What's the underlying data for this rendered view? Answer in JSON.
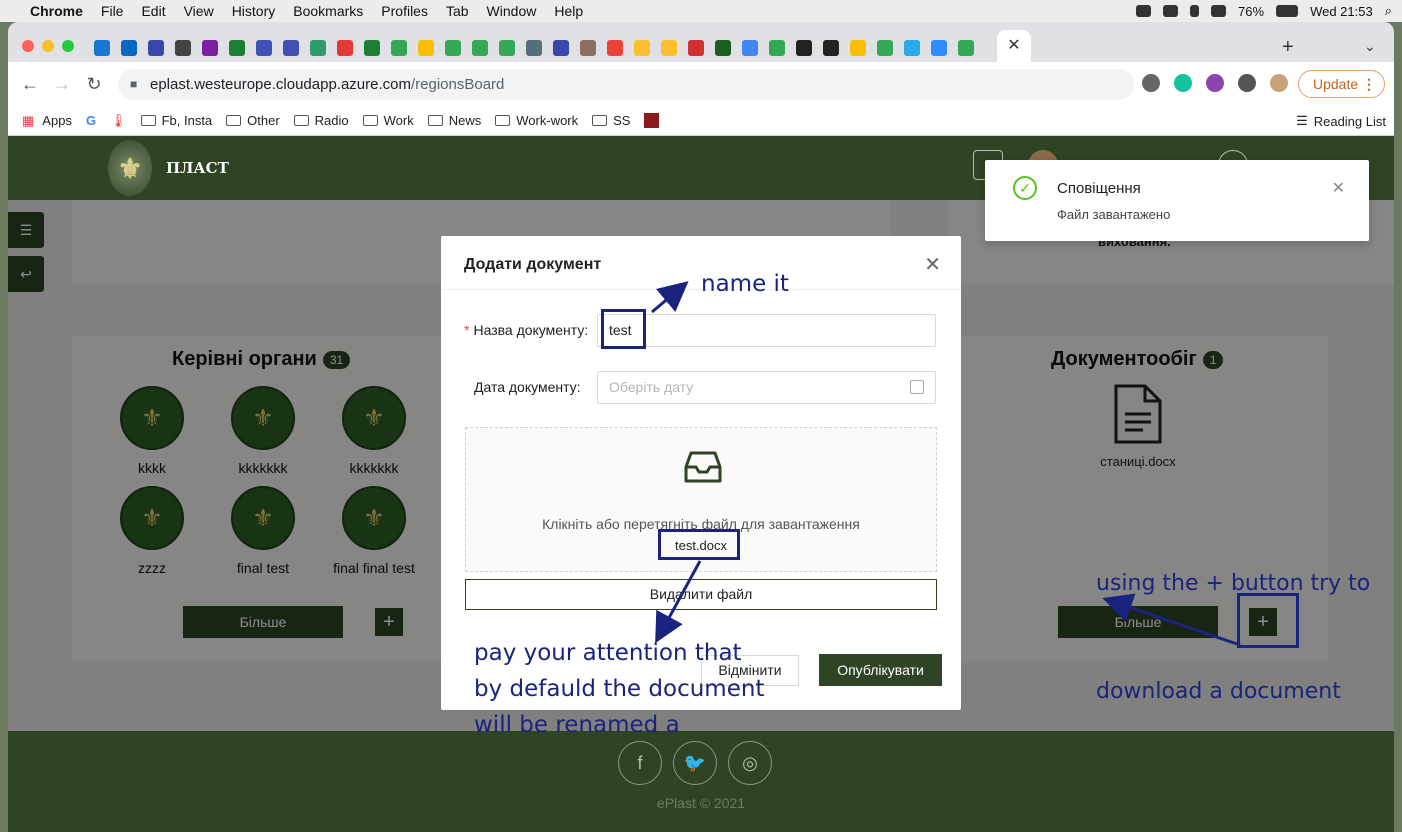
{
  "menubar": {
    "app": "Chrome",
    "items": [
      "File",
      "Edit",
      "View",
      "History",
      "Bookmarks",
      "Profiles",
      "Tab",
      "Window",
      "Help"
    ],
    "battery": "76%",
    "clock": "Wed 21:53"
  },
  "browser": {
    "url_host": "eplast.westeurope.cloudapp.azure.com",
    "url_path": "/regionsBoard",
    "update_label": "Update",
    "bookmarks": {
      "apps": "Apps",
      "items": [
        "Fb, Insta",
        "Other",
        "Radio",
        "Work",
        "News",
        "Work-work",
        "SS"
      ],
      "reading_list": "Reading List"
    }
  },
  "site": {
    "logo_text": "ПЛАСТ",
    "governing_bodies": {
      "title": "Керівні органи",
      "count": "31",
      "items": [
        "kkkk",
        "kkkkkkk",
        "kkkkkkk",
        "zzzz",
        "final test",
        "final final test"
      ],
      "more_label": "Більше",
      "plus_label": "+"
    },
    "doc_flow": {
      "title": "Документообіг",
      "count": "1",
      "file_name": "станиці.docx",
      "more_label": "Більше",
      "plus_label": "+"
    },
    "right_card_text": "виховання.",
    "footer_copyright": "ePlast © 2021"
  },
  "modal": {
    "title": "Додати документ",
    "name_label": "Назва документу",
    "name_value": "test",
    "date_label": "Дата документу",
    "date_placeholder": "Оберіть дату",
    "dropzone_text": "Клікніть або перетягніть файл для завантаження",
    "uploaded_file": "test.docx",
    "delete_label": "Видалити файл",
    "cancel_label": "Відмінити",
    "publish_label": "Опублікувати"
  },
  "notification": {
    "title": "Сповіщення",
    "message": "Файл завантажено"
  },
  "annotations": {
    "name_it": "name it",
    "attention_line1": "pay your attention that",
    "attention_line2": "by defauld the document",
    "attention_line3": "will be renamed a",
    "plus_line1": "using the + button try to",
    "plus_line2": "download a document"
  },
  "colors": {
    "brand_green": "#2f4424",
    "annotation_blue": "#1a237e",
    "success_green": "#52c41a"
  }
}
